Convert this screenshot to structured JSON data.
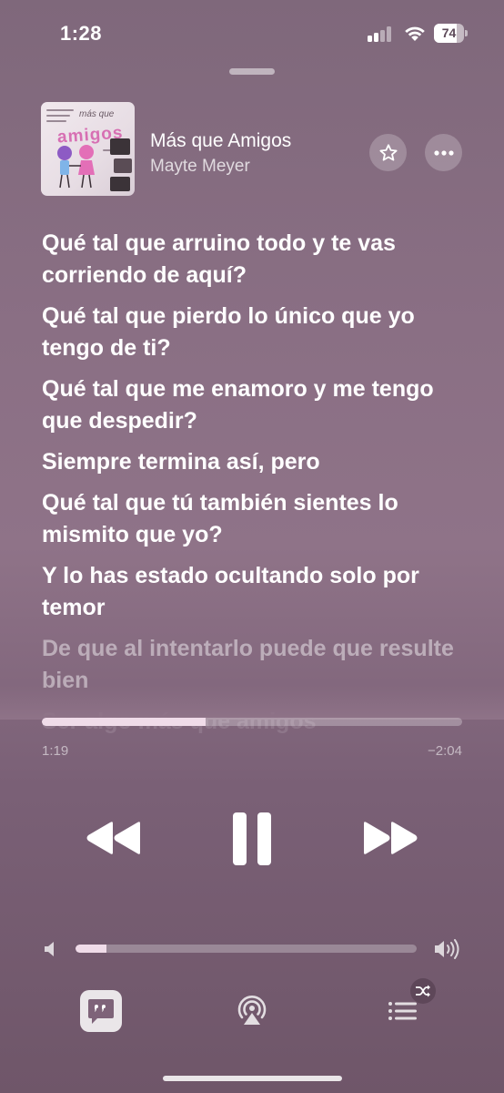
{
  "status_bar": {
    "time": "1:28",
    "battery": "74"
  },
  "now_playing": {
    "title": "Más que Amigos",
    "artist": "Mayte Meyer",
    "artwork": {
      "title_text": "amigos",
      "small_text": "más que"
    }
  },
  "lyrics": {
    "sung": [
      "Qué tal que arruino todo y te vas corriendo de aquí?",
      "Qué tal que pierdo lo único que yo tengo de ti?",
      "Qué tal que me enamoro y me tengo que despedir?",
      "Siempre termina así, pero",
      "Qué tal que tú también sientes lo mismito que yo?",
      "Y lo has estado ocultando solo por temor"
    ],
    "next": "De que al intentarlo puede que resulte bien",
    "after": "Ser algo más que amigos"
  },
  "playback": {
    "elapsed": "1:19",
    "remaining": "−2:04",
    "progress_fraction": 0.39,
    "state": "playing"
  },
  "volume": {
    "level_fraction": 0.09
  },
  "controls": {
    "rewind_icon": "rewind-icon",
    "pause_icon": "pause-icon",
    "forward_icon": "fast-forward-icon",
    "favorite_icon": "star-icon",
    "more_icon": "ellipsis-icon",
    "lyrics_icon": "lyrics-quote-icon",
    "airplay_icon": "airplay-icon",
    "queue_icon": "queue-list-icon",
    "shuffle_icon": "shuffle-icon"
  },
  "colors": {
    "accent_fill": "#f0dce9",
    "background": "#8f7388"
  }
}
